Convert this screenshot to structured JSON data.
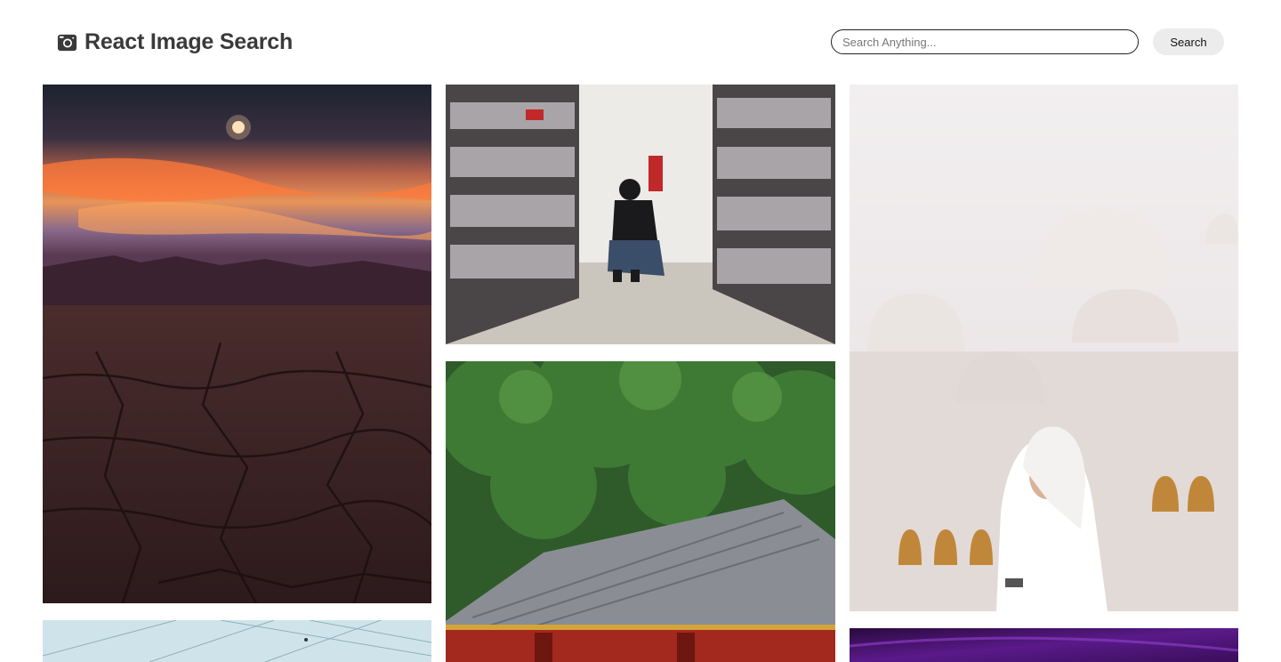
{
  "header": {
    "title": "React Image Search",
    "brand_icon": "camera-icon"
  },
  "search": {
    "placeholder": "Search Anything...",
    "value": "",
    "button_label": "Search"
  },
  "gallery": {
    "columns": 3,
    "images": [
      {
        "name": "desert-sunset-photo",
        "subject": "cracked desert floor under orange sunset"
      },
      {
        "name": "record-store-photo",
        "subject": "person crouching in record store aisle"
      },
      {
        "name": "white-mosque-photo",
        "subject": "woman in white headscarf before white domed mosque"
      },
      {
        "name": "glass-building-photo",
        "subject": "glass building facade"
      },
      {
        "name": "japanese-shrine-photo",
        "subject": "japanese shrine gate under green trees"
      },
      {
        "name": "purple-abstract-photo",
        "subject": "purple lit scene"
      }
    ]
  },
  "colors": {
    "accent": "#333333",
    "button_bg": "#ececec",
    "background": "#ffffff"
  }
}
